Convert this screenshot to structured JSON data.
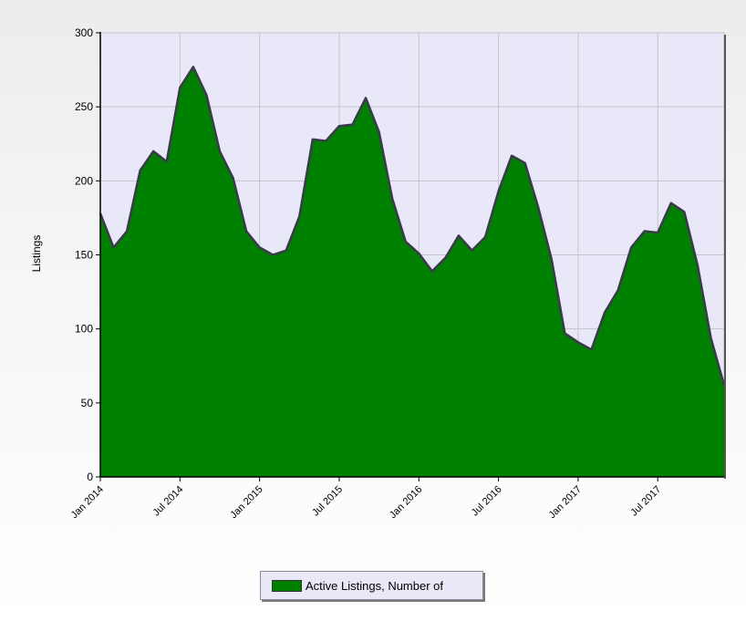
{
  "chart_data": {
    "type": "area",
    "ylabel": "Listings",
    "xlabel": "",
    "ylim": [
      0,
      300
    ],
    "y_ticks": [
      "0",
      "50",
      "100",
      "150",
      "200",
      "250",
      "300"
    ],
    "x_ticks": [
      "Jan 2014",
      "Jul 2014",
      "Jan 2015",
      "Jul 2015",
      "Jan 2016",
      "Jul 2016",
      "Jan 2017",
      "Jul 2017"
    ],
    "grid": true,
    "legend_position": "bottom-center",
    "colors": {
      "fill": "#008000",
      "line": "#3a3a4a",
      "plot_background": "#e8e8f8",
      "grid": "#c4c4cc"
    },
    "x": [
      "Jan 2014",
      "Feb 2014",
      "Mar 2014",
      "Apr 2014",
      "May 2014",
      "Jun 2014",
      "Jul 2014",
      "Aug 2014",
      "Sep 2014",
      "Oct 2014",
      "Nov 2014",
      "Dec 2014",
      "Jan 2015",
      "Feb 2015",
      "Mar 2015",
      "Apr 2015",
      "May 2015",
      "Jun 2015",
      "Jul 2015",
      "Aug 2015",
      "Sep 2015",
      "Oct 2015",
      "Nov 2015",
      "Dec 2015",
      "Jan 2016",
      "Feb 2016",
      "Mar 2016",
      "Apr 2016",
      "May 2016",
      "Jun 2016",
      "Jul 2016",
      "Aug 2016",
      "Sep 2016",
      "Oct 2016",
      "Nov 2016",
      "Dec 2016",
      "Jan 2017",
      "Feb 2017",
      "Mar 2017",
      "Apr 2017",
      "May 2017",
      "Jun 2017",
      "Jul 2017",
      "Aug 2017",
      "Sep 2017",
      "Oct 2017",
      "Nov 2017",
      "Dec 2017"
    ],
    "series": [
      {
        "name": "Active Listings, Number of",
        "values": [
          178,
          155,
          166,
          207,
          220,
          213,
          263,
          277,
          258,
          220,
          202,
          166,
          155,
          150,
          153,
          176,
          228,
          227,
          237,
          238,
          256,
          233,
          188,
          159,
          151,
          139,
          148,
          163,
          153,
          162,
          193,
          217,
          212,
          182,
          147,
          97,
          91,
          86,
          111,
          126,
          155,
          166,
          165,
          185,
          179,
          143,
          94,
          62
        ]
      }
    ]
  },
  "legend": {
    "label": "Active Listings, Number of"
  }
}
